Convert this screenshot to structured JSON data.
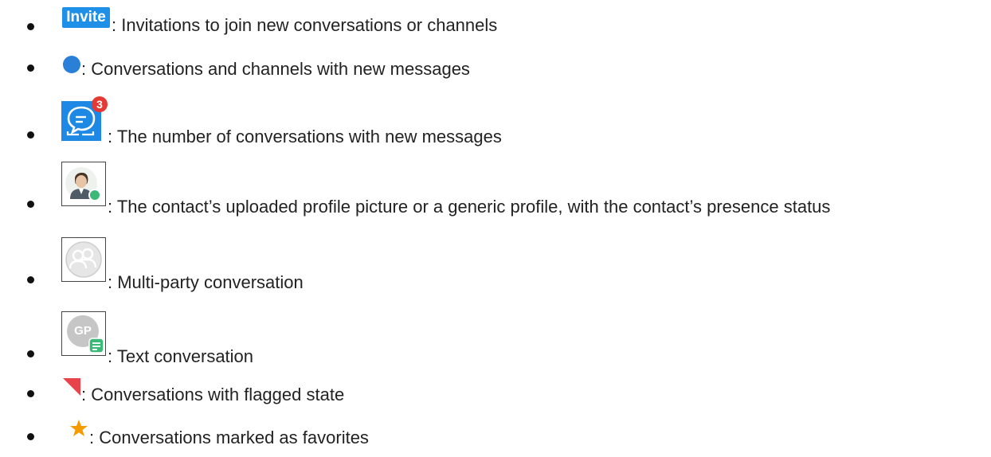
{
  "legend": {
    "items": [
      {
        "icon": "invite-badge",
        "badge_text": "Invite",
        "text": ": Invitations to join new conversations or channels",
        "color": "#1e90e8"
      },
      {
        "icon": "blue-dot-icon",
        "text": ": Conversations and channels with new messages",
        "color": "#2a7fd6"
      },
      {
        "icon": "chat-bubble-icon",
        "badge_count": "3",
        "text": ": The number of conversations with new messages",
        "color": "#1e88e5",
        "badge_color": "#e53935"
      },
      {
        "icon": "profile-picture-icon",
        "text": ": The contact’s uploaded profile picture or a generic profile, with the contact’s presence status",
        "presence_color": "#3cb878"
      },
      {
        "icon": "multi-party-icon",
        "text": ": Multi-party conversation"
      },
      {
        "icon": "text-conversation-icon",
        "initials": "GP",
        "text": ": Text conversation",
        "color": "#c6c6c6",
        "sub_icon_color": "#3cb878"
      },
      {
        "icon": "flag-icon",
        "text": ": Conversations with flagged state",
        "color": "#e8424a"
      },
      {
        "icon": "star-icon",
        "text": ": Conversations marked as favorites",
        "color": "#f59b00"
      }
    ]
  }
}
